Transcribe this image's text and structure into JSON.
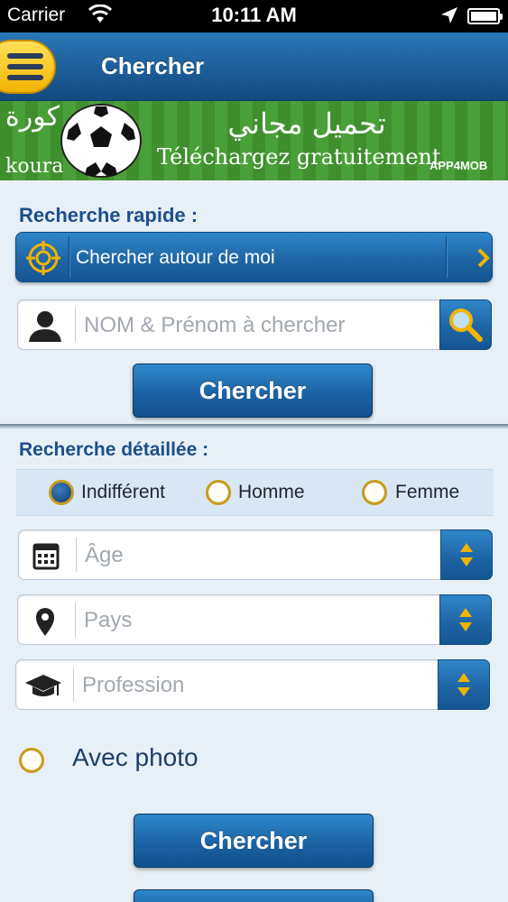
{
  "status_bar": {
    "carrier": "Carrier",
    "time": "10:11 AM",
    "wifi_icon": "wifi-icon",
    "location_icon": "location-arrow-icon",
    "battery_icon": "battery-icon"
  },
  "nav": {
    "title": "Chercher",
    "menu_icon": "hamburger-menu-icon"
  },
  "banner": {
    "arabic_brand": "كورة",
    "latin_brand": "koura",
    "arabic_text": "تحميل مجاني",
    "french_text": "Téléchargez gratuitement",
    "badge": "APP4MOB"
  },
  "quick_search": {
    "title": "Recherche rapide :",
    "around_me_label": "Chercher autour de moi",
    "name_placeholder": "NOM & Prénom à chercher",
    "button_label": "Chercher"
  },
  "detailed_search": {
    "title": "Recherche détaillée :",
    "gender_options": [
      {
        "label": "Indifférent",
        "selected": true
      },
      {
        "label": "Homme",
        "selected": false
      },
      {
        "label": "Femme",
        "selected": false
      }
    ],
    "age_placeholder": "Âge",
    "country_placeholder": "Pays",
    "profession_placeholder": "Profession",
    "with_photo_label": "Avec photo",
    "with_photo_checked": false,
    "button_label": "Chercher"
  },
  "colors": {
    "accent_blue": "#1f66a6",
    "gold": "#f2b400",
    "title_blue": "#1b4f8a",
    "background": "#e8f0f7"
  }
}
